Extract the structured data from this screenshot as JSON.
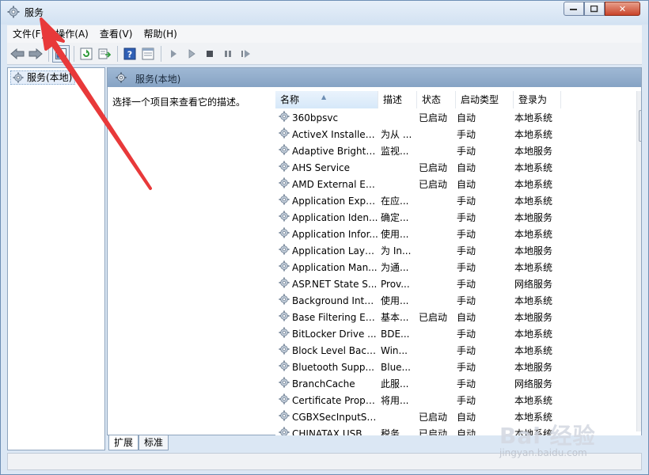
{
  "window": {
    "title": "服务"
  },
  "menu": [
    "文件(F)",
    "操作(A)",
    "查看(V)",
    "帮助(H)"
  ],
  "tree": {
    "root_label": "服务(本地)"
  },
  "right_pane": {
    "header": "服务(本地)",
    "description_hint": "选择一个项目来查看它的描述。"
  },
  "columns": {
    "name": "名称",
    "desc": "描述",
    "status": "状态",
    "startup": "启动类型",
    "logon": "登录为"
  },
  "services": [
    {
      "name": "360bpsvc",
      "desc": "",
      "status": "已启动",
      "startup": "自动",
      "logon": "本地系统"
    },
    {
      "name": "ActiveX Installer ...",
      "desc": "为从 ...",
      "status": "",
      "startup": "手动",
      "logon": "本地系统"
    },
    {
      "name": "Adaptive Brightn...",
      "desc": "监视...",
      "status": "",
      "startup": "手动",
      "logon": "本地服务"
    },
    {
      "name": "AHS Service",
      "desc": "",
      "status": "已启动",
      "startup": "自动",
      "logon": "本地系统"
    },
    {
      "name": "AMD External Ev...",
      "desc": "",
      "status": "已启动",
      "startup": "自动",
      "logon": "本地系统"
    },
    {
      "name": "Application Expe...",
      "desc": "在应...",
      "status": "",
      "startup": "手动",
      "logon": "本地系统"
    },
    {
      "name": "Application Iden...",
      "desc": "确定...",
      "status": "",
      "startup": "手动",
      "logon": "本地服务"
    },
    {
      "name": "Application Infor...",
      "desc": "使用...",
      "status": "",
      "startup": "手动",
      "logon": "本地系统"
    },
    {
      "name": "Application Laye...",
      "desc": "为 In...",
      "status": "",
      "startup": "手动",
      "logon": "本地服务"
    },
    {
      "name": "Application Man...",
      "desc": "为通...",
      "status": "",
      "startup": "手动",
      "logon": "本地系统"
    },
    {
      "name": "ASP.NET State S...",
      "desc": "Prov...",
      "status": "",
      "startup": "手动",
      "logon": "网络服务"
    },
    {
      "name": "Background Inte...",
      "desc": "使用...",
      "status": "",
      "startup": "手动",
      "logon": "本地系统"
    },
    {
      "name": "Base Filtering En...",
      "desc": "基本...",
      "status": "已启动",
      "startup": "自动",
      "logon": "本地服务"
    },
    {
      "name": "BitLocker Drive ...",
      "desc": "BDE...",
      "status": "",
      "startup": "手动",
      "logon": "本地系统"
    },
    {
      "name": "Block Level Back...",
      "desc": "Win...",
      "status": "",
      "startup": "手动",
      "logon": "本地系统"
    },
    {
      "name": "Bluetooth Supp...",
      "desc": "Blue...",
      "status": "",
      "startup": "手动",
      "logon": "本地服务"
    },
    {
      "name": "BranchCache",
      "desc": "此服...",
      "status": "",
      "startup": "手动",
      "logon": "网络服务"
    },
    {
      "name": "Certificate Propa...",
      "desc": "将用...",
      "status": "",
      "startup": "手动",
      "logon": "本地系统"
    },
    {
      "name": "CGBXSecInputSe...",
      "desc": "",
      "status": "已启动",
      "startup": "自动",
      "logon": "本地系统"
    },
    {
      "name": "CHINATAX USB ...",
      "desc": "税务...",
      "status": "已启动",
      "startup": "自动",
      "logon": "本地系统"
    }
  ],
  "tabs": [
    "扩展",
    "标准"
  ],
  "watermark": {
    "main": "Bai 经验",
    "sub": "jingyan.baidu.com"
  },
  "colors": {
    "annotation_arrow": "#e8393a",
    "header_blue": "#8ea9c9"
  }
}
